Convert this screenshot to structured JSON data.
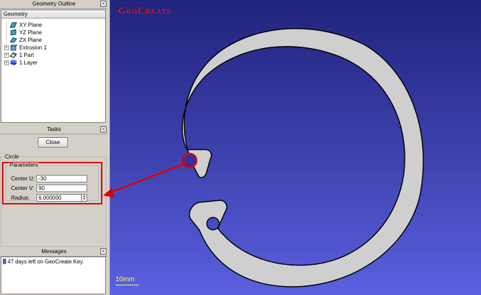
{
  "outline": {
    "title": "Geometry Outline",
    "header": "Geometry",
    "items": [
      {
        "label": "XY Plane",
        "icon": "plane-icon"
      },
      {
        "label": "YZ Plane",
        "icon": "plane-icon"
      },
      {
        "label": "ZX Plane",
        "icon": "plane-icon"
      },
      {
        "label": "Extrusion 1",
        "icon": "extrusion-icon"
      },
      {
        "label": "1 Part",
        "icon": "part-icon"
      },
      {
        "label": "1 Layer",
        "icon": "layer-icon"
      }
    ]
  },
  "tasks": {
    "title": "Tasks",
    "close_label": "Close"
  },
  "circle": {
    "group_title": "Circle",
    "params_title": "Parameters",
    "center_u_label": "Center U:",
    "center_u_value": "-30",
    "center_v_label": "Center V:",
    "center_v_value": "90",
    "radius_label": "Radius:",
    "radius_value": "6.000000"
  },
  "messages": {
    "title": "Messages",
    "line": "47 days left on GeoCreate Key."
  },
  "viewport": {
    "brand": "GeoCreate",
    "scale_label": "10mm"
  },
  "colors": {
    "highlight": "#e00000",
    "part_fill": "#cfcfcf",
    "scale": "#ffff40"
  }
}
